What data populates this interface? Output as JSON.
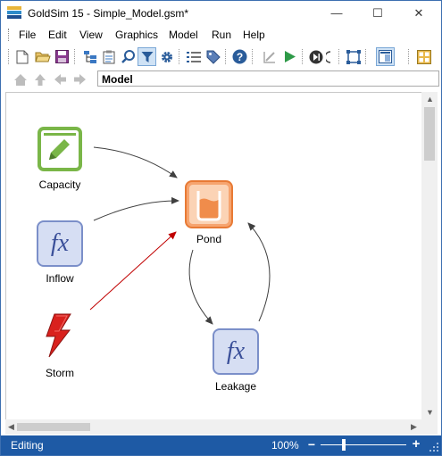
{
  "window": {
    "title": "GoldSim 15  - Simple_Model.gsm*",
    "controls": {
      "minimize": "—",
      "maximize": "☐",
      "close": "✕"
    }
  },
  "menu": {
    "items": [
      "File",
      "Edit",
      "View",
      "Graphics",
      "Model",
      "Run",
      "Help"
    ]
  },
  "toolbar": {
    "icons": [
      "new-file-icon",
      "open-folder-icon",
      "save-icon",
      "browser-view-icon",
      "clipboard-icon",
      "find-icon",
      "filter-icon",
      "settings-icon",
      "list-icon",
      "tag-icon",
      "help-icon",
      "edit-mode-icon",
      "run-icon",
      "step-icon",
      "stop-icon",
      "select-icon",
      "panel-icon",
      "grid-icon"
    ]
  },
  "navigation": {
    "address": "Model",
    "icons": [
      "home-icon",
      "up-icon",
      "back-icon",
      "forward-icon"
    ]
  },
  "model": {
    "nodes": {
      "capacity": {
        "label": "Capacity",
        "icon": "data-element-icon",
        "color": "#7ab648"
      },
      "inflow": {
        "label": "Inflow",
        "icon": "expression-fx-icon",
        "color": "#7b8fc9"
      },
      "storm": {
        "label": "Storm",
        "icon": "lightning-event-icon",
        "color": "#d9211d"
      },
      "pond": {
        "label": "Pond",
        "icon": "reservoir-icon",
        "color": "#f08c4b"
      },
      "leakage": {
        "label": "Leakage",
        "icon": "expression-fx-icon",
        "color": "#7b8fc9"
      }
    },
    "links": [
      {
        "from": "Capacity",
        "to": "Pond",
        "color": "#404040"
      },
      {
        "from": "Inflow",
        "to": "Pond",
        "color": "#404040"
      },
      {
        "from": "Storm",
        "to": "Pond",
        "color": "#c00000"
      },
      {
        "from": "Pond",
        "to": "Leakage",
        "color": "#404040"
      },
      {
        "from": "Leakage",
        "to": "Pond",
        "color": "#404040"
      }
    ]
  },
  "status": {
    "mode": "Editing",
    "zoom": "100%",
    "zoom_minus": "−",
    "zoom_plus": "+",
    "zoom_level_fraction": 0.27
  },
  "colors": {
    "status_bar": "#1e5aa5",
    "accent": "#3c6fb0"
  }
}
